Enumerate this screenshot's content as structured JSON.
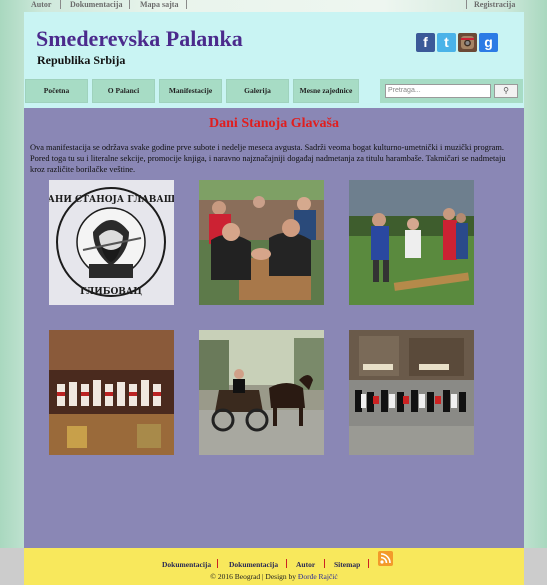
{
  "topbar": {
    "links": [
      "Autor",
      "Dokumentacija",
      "Mapa sajta"
    ],
    "right_link": "Registracija"
  },
  "header": {
    "title": "Smederevska Palanka",
    "subtitle": "Republika Srbija",
    "social": [
      "facebook-icon",
      "twitter-icon",
      "instagram-icon",
      "google-icon"
    ]
  },
  "nav": {
    "items": [
      "Početna",
      "O Palanci",
      "Manifestacije",
      "Galerija",
      "Mesne zajednice"
    ],
    "search_placeholder": "Pretraga...",
    "search_button": "⚲"
  },
  "main": {
    "title": "Dani Stanoja Glavaša",
    "intro": "Ova manifestacija se održava svake godine prve subote i nedelje meseca avgusta. Sadrži veoma bogat kulturno-umetnički i muzički program. Pored toga tu su i literalne sekcije, promocije knjiga, i naravno najznačajniji događaj nadmetanja za titulu harambaše. Takmičari se nadmetaju kroz različite borilačke veštine.",
    "logo_text_top": "ДАНИ СТАНОЈА ГЛАВАША",
    "logo_text_bottom": "ГЛИБОВАЦ"
  },
  "footer": {
    "links": [
      "Dokumentacija",
      "Dokumentacija",
      "Autor",
      "Sitemap"
    ],
    "copyright": "© 2016 Beograd | Design by",
    "author": "Đorđe Rajčić"
  },
  "colors": {
    "title": "#4b2a8c",
    "page_title": "#e01e1e",
    "header_bg": "#c9f4f3",
    "nav_btn": "#a7dcc5",
    "content_bg": "#8a87b5",
    "footer_bg": "#f8e85c"
  }
}
